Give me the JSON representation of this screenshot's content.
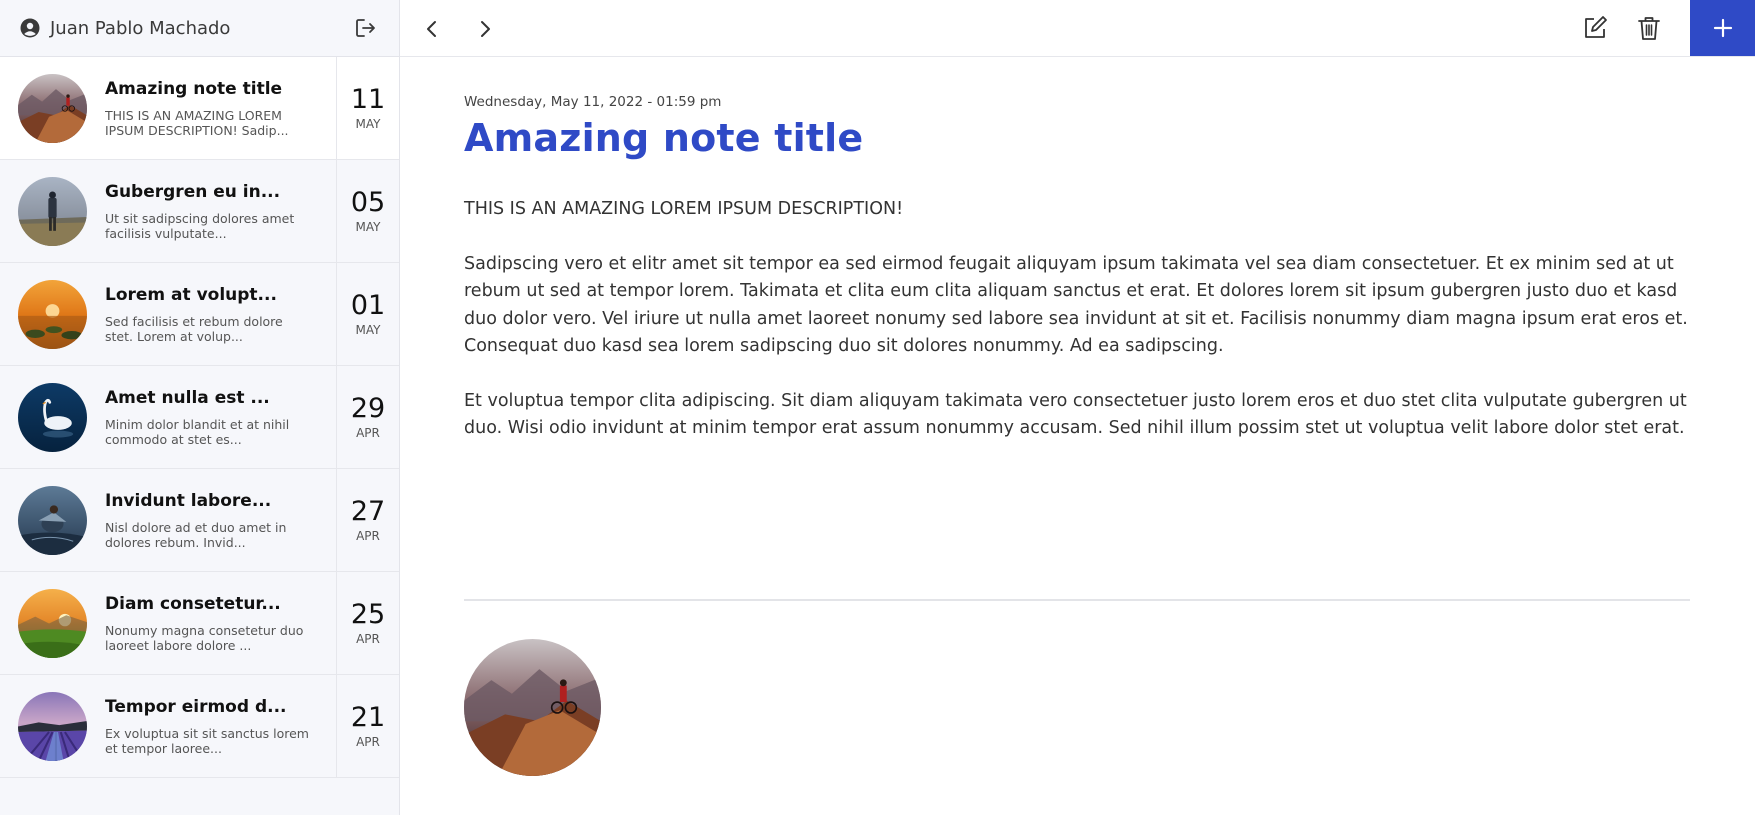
{
  "user": {
    "name": "Juan Pablo Machado"
  },
  "notes": [
    {
      "title": "Amazing note title",
      "desc": "THIS IS AN AMAZING LOREM IPSUM DESCRIPTION! Sadip...",
      "day": "11",
      "month": "MAY",
      "thumb": "mountain-biker"
    },
    {
      "title": "Gubergren eu in...",
      "desc": "Ut sit sadipscing dolores amet facilisis vulputate...",
      "day": "05",
      "month": "MAY",
      "thumb": "hiker-field"
    },
    {
      "title": "Lorem at volupt...",
      "desc": "Sed facilisis et rebum dolore stet. Lorem at volup...",
      "day": "01",
      "month": "MAY",
      "thumb": "sunset-stones"
    },
    {
      "title": "Amet nulla est ...",
      "desc": "Minim dolor blandit et at nihil commodo at stet es...",
      "day": "29",
      "month": "APR",
      "thumb": "swan-lake"
    },
    {
      "title": "Invidunt labore...",
      "desc": "Nisl dolore ad et duo amet in dolores rebum. Invid...",
      "day": "27",
      "month": "APR",
      "thumb": "bird-water"
    },
    {
      "title": "Diam consetetur...",
      "desc": "Nonumy magna consetetur duo laoreet labore dolore ...",
      "day": "25",
      "month": "APR",
      "thumb": "sunrise-valley"
    },
    {
      "title": "Tempor eirmod d...",
      "desc": "Ex voluptua sit sit sanctus lorem et tempor laoree...",
      "day": "21",
      "month": "APR",
      "thumb": "lavender-field"
    }
  ],
  "active_note": {
    "timestamp": "Wednesday, May 11, 2022 - 01:59 pm",
    "title": "Amazing note title",
    "paragraphs": [
      "THIS IS AN AMAZING LOREM IPSUM DESCRIPTION!",
      "Sadipscing vero et elitr amet sit tempor ea sed eirmod feugait aliquyam ipsum takimata vel sea diam consectetuer. Et ex minim sed at ut rebum ut sed at tempor lorem. Takimata et clita eum clita aliquam sanctus et erat. Et dolores lorem sit ipsum gubergren justo duo et kasd duo dolor vero. Vel iriure ut nulla amet laoreet nonumy sed labore sea invidunt at sit et. Facilisis nonummy diam magna ipsum erat eros et. Consequat duo kasd sea lorem sadipscing duo sit dolores nonummy. Ad ea sadipscing.",
      "Et voluptua tempor clita adipiscing. Sit diam aliquyam takimata vero consectetuer justo lorem eros et duo stet clita vulputate gubergren ut duo. Wisi odio invidunt at minim tempor erat assum nonummy accusam. Sed nihil illum possim stet ut voluptua velit labore dolor stet erat."
    ],
    "attachment": "mountain-biker"
  },
  "icons": {
    "user": "user-circle-icon",
    "logout": "logout-icon",
    "prev": "chevron-left-icon",
    "next": "chevron-right-icon",
    "edit": "edit-icon",
    "delete": "trash-icon",
    "add": "plus-icon"
  },
  "colors": {
    "accent": "#2f4ac6",
    "sidebar_bg": "#f6f7fb"
  }
}
